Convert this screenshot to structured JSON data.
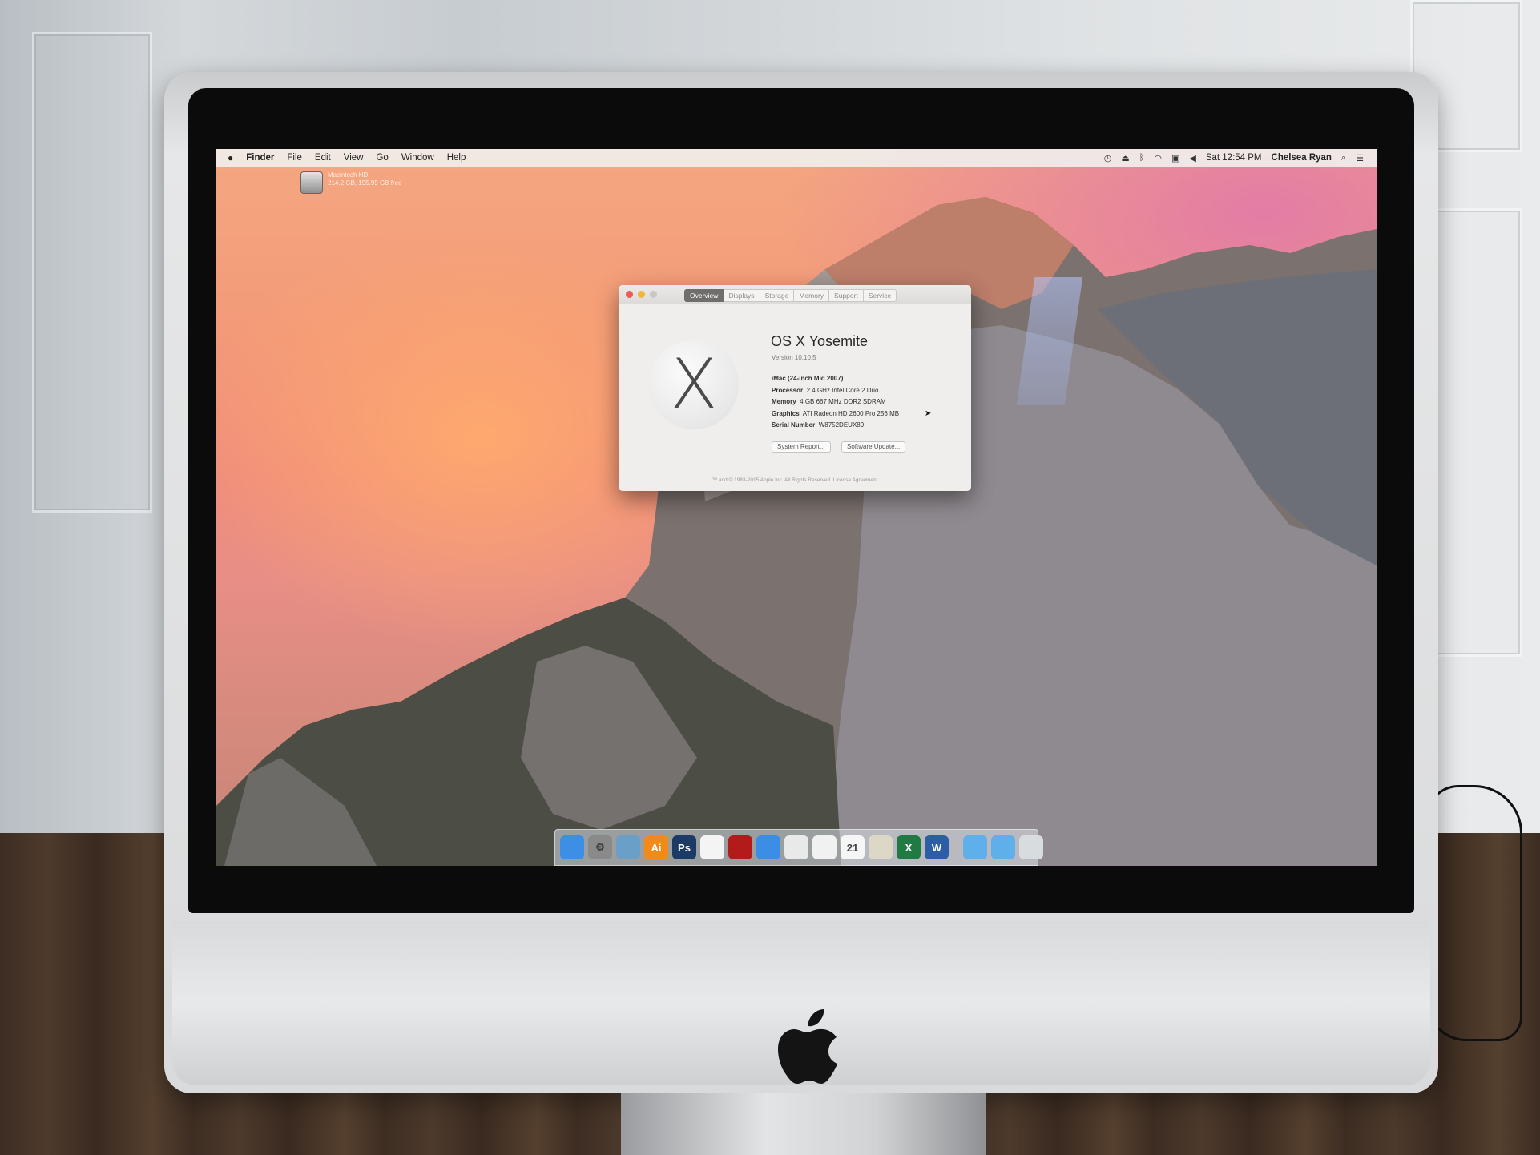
{
  "menubar": {
    "apple": "",
    "app": "Finder",
    "menus": [
      "File",
      "Edit",
      "View",
      "Go",
      "Window",
      "Help"
    ],
    "clock": "Sat 12:54 PM",
    "user": "Chelsea Ryan"
  },
  "desktop": {
    "disk_name": "Macintosh HD",
    "disk_info": "214.2 GB, 195.99 GB free"
  },
  "about": {
    "tabs": [
      "Overview",
      "Displays",
      "Storage",
      "Memory",
      "Support",
      "Service"
    ],
    "active_tab": "Overview",
    "logo": "X",
    "title": "OS X Yosemite",
    "version": "Version 10.10.5",
    "model": "iMac (24-inch Mid 2007)",
    "processor_label": "Processor",
    "processor": "2.4 GHz Intel Core 2 Duo",
    "memory_label": "Memory",
    "memory": "4 GB 667 MHz DDR2 SDRAM",
    "graphics_label": "Graphics",
    "graphics": "ATI Radeon HD 2600 Pro 256 MB",
    "serial_label": "Serial Number",
    "serial": "W8752DEUX89",
    "system_report": "System Report...",
    "software_update": "Software Update...",
    "copyright": "™ and © 1983-2015 Apple Inc. All Rights Reserved. License Agreement"
  },
  "dock": {
    "apps": [
      {
        "name": "finder",
        "label": "",
        "color": "#3d8fe6"
      },
      {
        "name": "system-preferences",
        "label": "⚙",
        "color": "#8a8a8a"
      },
      {
        "name": "preview",
        "label": "",
        "color": "#6aa0c8"
      },
      {
        "name": "illustrator",
        "label": "Ai",
        "color": "#f28a18"
      },
      {
        "name": "photoshop",
        "label": "Ps",
        "color": "#1b3b66"
      },
      {
        "name": "acrobat-reader",
        "label": "",
        "color": "#f4f4f4"
      },
      {
        "name": "acrobat",
        "label": "",
        "color": "#b31b1b"
      },
      {
        "name": "safari",
        "label": "",
        "color": "#3a8ee6"
      },
      {
        "name": "chrome",
        "label": "",
        "color": "#e9e9e9"
      },
      {
        "name": "textedit",
        "label": "",
        "color": "#f1f1f1"
      },
      {
        "name": "calendar",
        "label": "21",
        "color": "#f6f6f6"
      },
      {
        "name": "notes",
        "label": "",
        "color": "#ddd7c8"
      },
      {
        "name": "excel",
        "label": "X",
        "color": "#1f7a44"
      },
      {
        "name": "word",
        "label": "W",
        "color": "#2b5ea7"
      }
    ],
    "folders": [
      {
        "name": "applications-folder",
        "color": "#5fb0ea"
      },
      {
        "name": "downloads-folder",
        "color": "#5fb0ea"
      },
      {
        "name": "trash",
        "color": "#d9dcdf"
      }
    ]
  }
}
